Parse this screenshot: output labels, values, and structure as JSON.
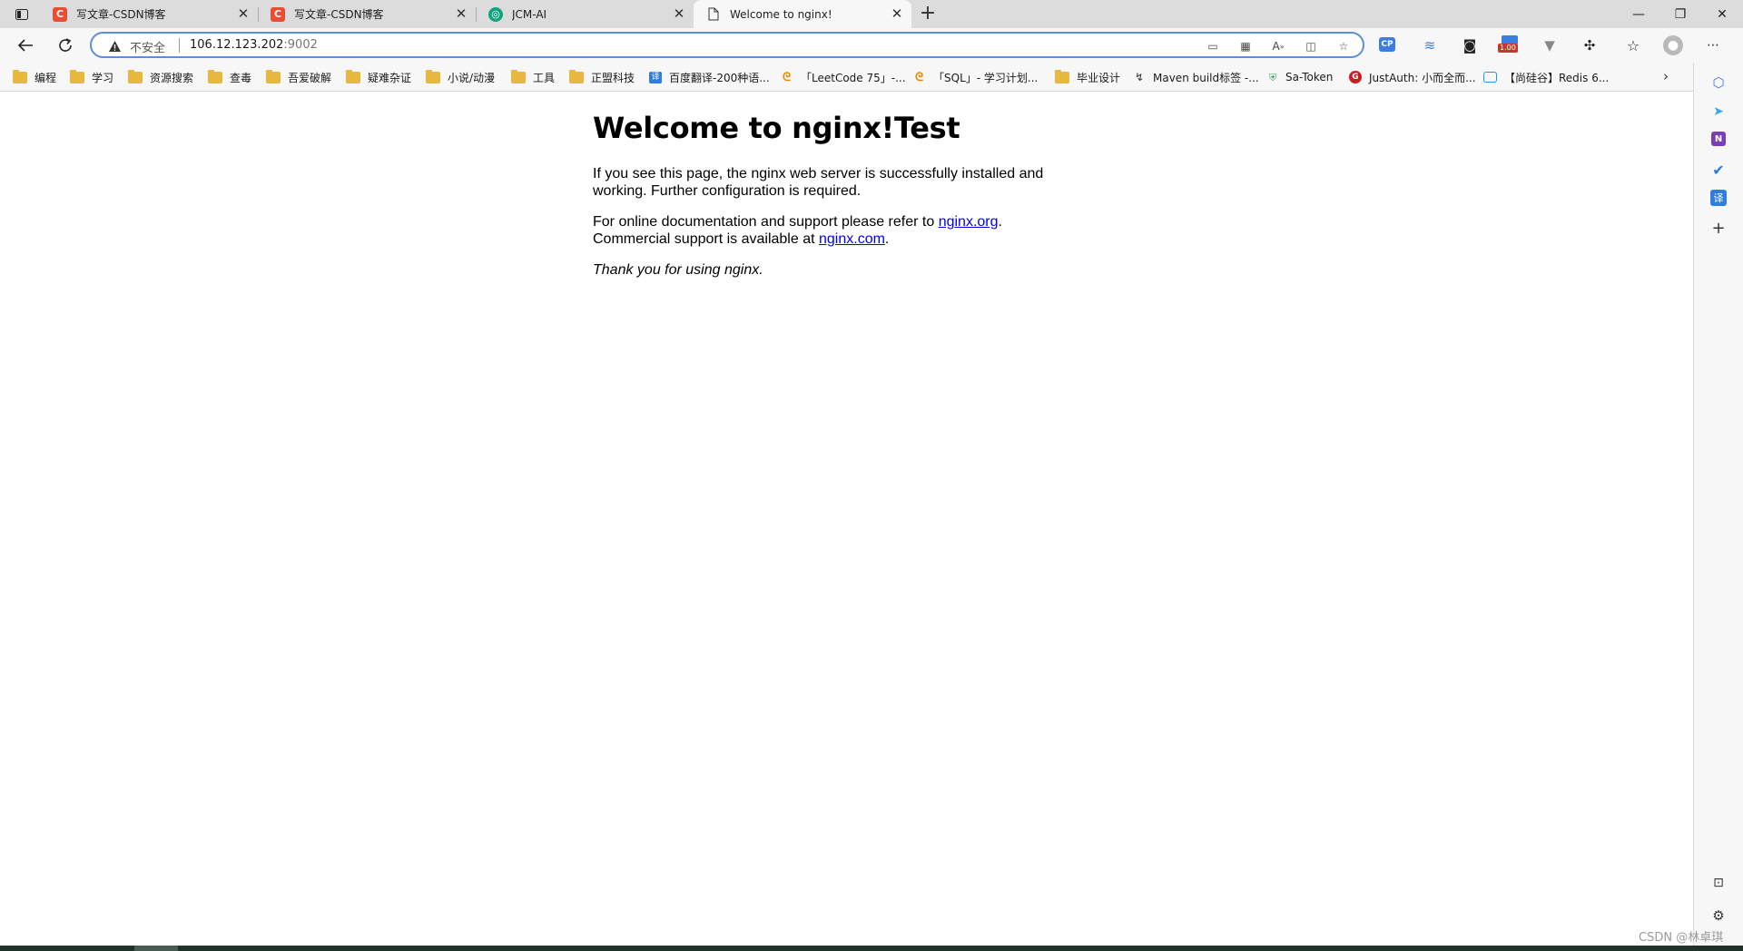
{
  "tabs": [
    {
      "title": "写文章-CSDN博客",
      "icon": "csdn-icon",
      "active": false
    },
    {
      "title": "写文章-CSDN博客",
      "icon": "csdn-icon",
      "active": false
    },
    {
      "title": "JCM-AI",
      "icon": "chatgpt-icon",
      "active": false
    },
    {
      "title": "Welcome to nginx!",
      "icon": "page-icon",
      "active": true
    }
  ],
  "address": {
    "security_label": "不安全",
    "url_host": "106.12.123.202",
    "url_port": ":9002"
  },
  "extensions": {
    "badge": "1.00"
  },
  "bookmarks": [
    {
      "label": "编程",
      "type": "folder"
    },
    {
      "label": "学习",
      "type": "folder"
    },
    {
      "label": "资源搜索",
      "type": "folder"
    },
    {
      "label": "查毒",
      "type": "folder"
    },
    {
      "label": "吾爱破解",
      "type": "folder"
    },
    {
      "label": "疑难杂证",
      "type": "folder"
    },
    {
      "label": "小说/动漫",
      "type": "folder"
    },
    {
      "label": "工具",
      "type": "folder"
    },
    {
      "label": "正盟科技",
      "type": "folder"
    },
    {
      "label": "百度翻译-200种语...",
      "type": "link",
      "icon": "translate-icon"
    },
    {
      "label": "「LeetCode 75」-...",
      "type": "link",
      "icon": "leetcode-icon"
    },
    {
      "label": "「SQL」- 学习计划...",
      "type": "link",
      "icon": "leetcode-icon"
    },
    {
      "label": "毕业设计",
      "type": "folder"
    },
    {
      "label": "Maven build标签 -...",
      "type": "link",
      "icon": "maven-icon"
    },
    {
      "label": "Sa-Token",
      "type": "link",
      "icon": "shield-icon"
    },
    {
      "label": "JustAuth: 小而全而...",
      "type": "link",
      "icon": "gitee-icon"
    },
    {
      "label": "【尚硅谷】Redis 6...",
      "type": "link",
      "icon": "bilibili-icon"
    }
  ],
  "page": {
    "heading": "Welcome to nginx!Test",
    "p1": "If you see this page, the nginx web server is successfully installed and working. Further configuration is required.",
    "p2_before": "For online documentation and support please refer to ",
    "link1": "nginx.org",
    "p2_mid": ".",
    "p2_line2": "Commercial support is available at ",
    "link2": "nginx.com",
    "p2_end": ".",
    "p3": "Thank you for using nginx."
  },
  "watermark": "CSDN @林卓琪",
  "colors": {
    "link": "#0000ee",
    "csdn": "#e94e35",
    "chatgpt": "#10a37f",
    "folder": "#e8b73e",
    "address_focus": "#5b8fd8"
  }
}
